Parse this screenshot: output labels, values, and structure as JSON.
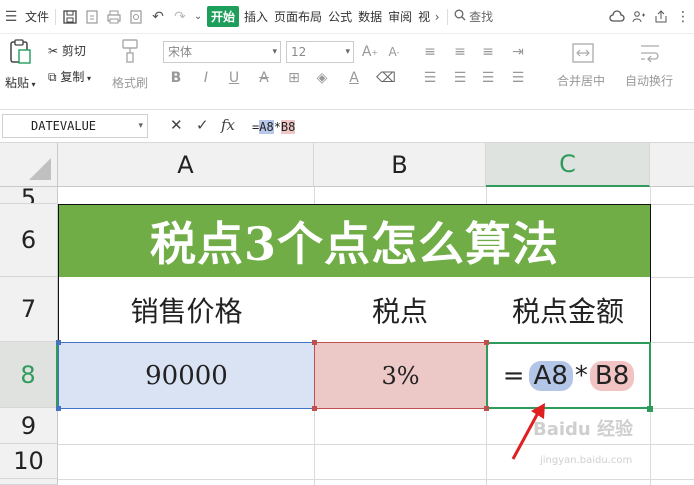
{
  "menubar": {
    "file_label": "文件",
    "tabs": [
      "开始",
      "插入",
      "页面布局",
      "公式",
      "数据",
      "审阅",
      "视"
    ],
    "active_tab": "开始",
    "search_label": "查找"
  },
  "ribbon": {
    "paste_label": "粘贴",
    "cut_label": "剪切",
    "copy_label": "复制",
    "format_painter_label": "格式刷",
    "font_name": "宋体",
    "font_size": "12",
    "merge_label": "合并居中",
    "wrap_label": "自动换行"
  },
  "formulabar": {
    "name_box": "DATEVALUE",
    "fx_label": "fx",
    "formula_prefix": "=",
    "formula_ref_a": "A8",
    "formula_op": "*",
    "formula_ref_b": "B8"
  },
  "grid": {
    "columns": [
      "A",
      "B",
      "C"
    ],
    "active_column": "C",
    "rows": [
      "5",
      "6",
      "7",
      "8",
      "9",
      "10"
    ],
    "active_row": "8",
    "title": "税点3个点怎么算法",
    "header_a": "销售价格",
    "header_b": "税点",
    "header_c": "税点金额",
    "value_a": "90000",
    "value_b": "3%",
    "edit_prefix": "=",
    "edit_ref_a": "A8",
    "edit_op": "*",
    "edit_ref_b": "B8"
  },
  "watermark": {
    "main": "Baidu 经验",
    "sub": "jingyan.baidu.com"
  },
  "colors": {
    "accent": "#1e9e5b",
    "title_fill": "#70ad47",
    "ref_a_fill": "#dae3f3",
    "ref_b_fill": "#ecc8c7",
    "arrow": "#e02020"
  }
}
